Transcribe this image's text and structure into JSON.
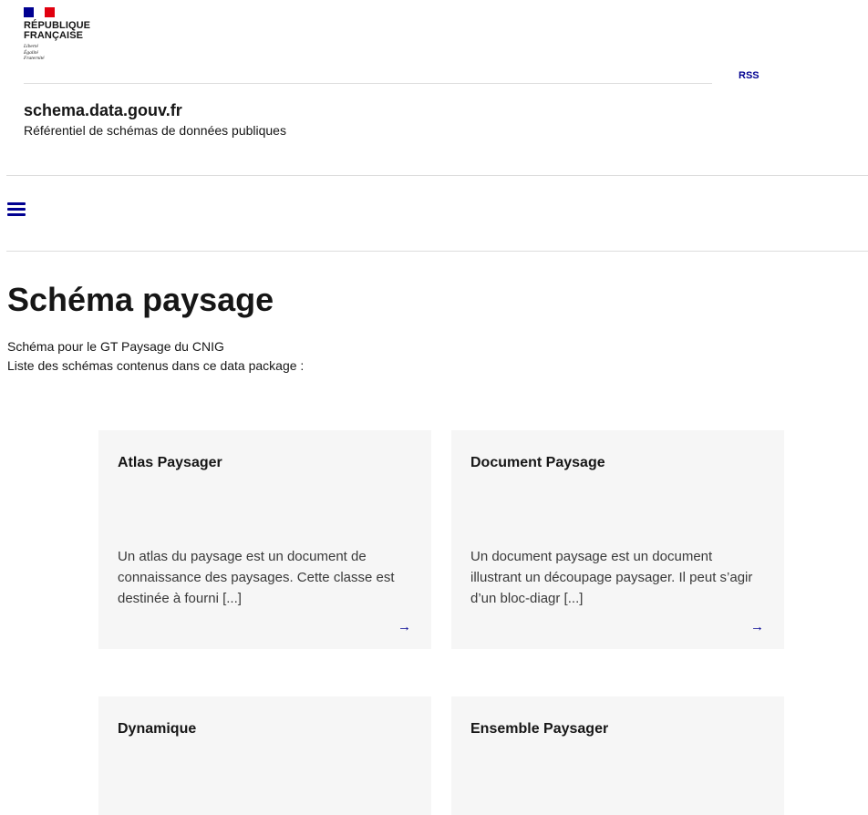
{
  "header": {
    "logo_text": "RÉPUBLIQUE\nFRANÇAISE",
    "motto": [
      "Liberté",
      "Égalité",
      "Fraternité"
    ],
    "rss_label": "RSS",
    "service_title": "schema.data.gouv.fr",
    "service_tagline": "Référentiel de schémas de données publiques"
  },
  "nav": {
    "menu_icon": "hamburger-menu-icon"
  },
  "page": {
    "title": "Schéma paysage",
    "description": "Schéma pour le GT Paysage du CNIG",
    "list_intro": "Liste des schémas contenus dans ce data package :"
  },
  "cards": [
    {
      "title": "Atlas Paysager",
      "description": "Un atlas du paysage est un document de connaissance des paysages. Cette classe est destinée à fourni [...]",
      "arrow": "→"
    },
    {
      "title": "Document Paysage",
      "description": "Un document paysage est un document illustrant un découpage paysager. Il peut s’agir d’un bloc-diagr [...]",
      "arrow": "→"
    },
    {
      "title": "Dynamique",
      "description": "",
      "arrow": ""
    },
    {
      "title": "Ensemble Paysager",
      "description": "",
      "arrow": ""
    }
  ],
  "colors": {
    "brand_blue": "#000091",
    "brand_red": "#e1000f",
    "card_bg": "#f6f6f6"
  }
}
